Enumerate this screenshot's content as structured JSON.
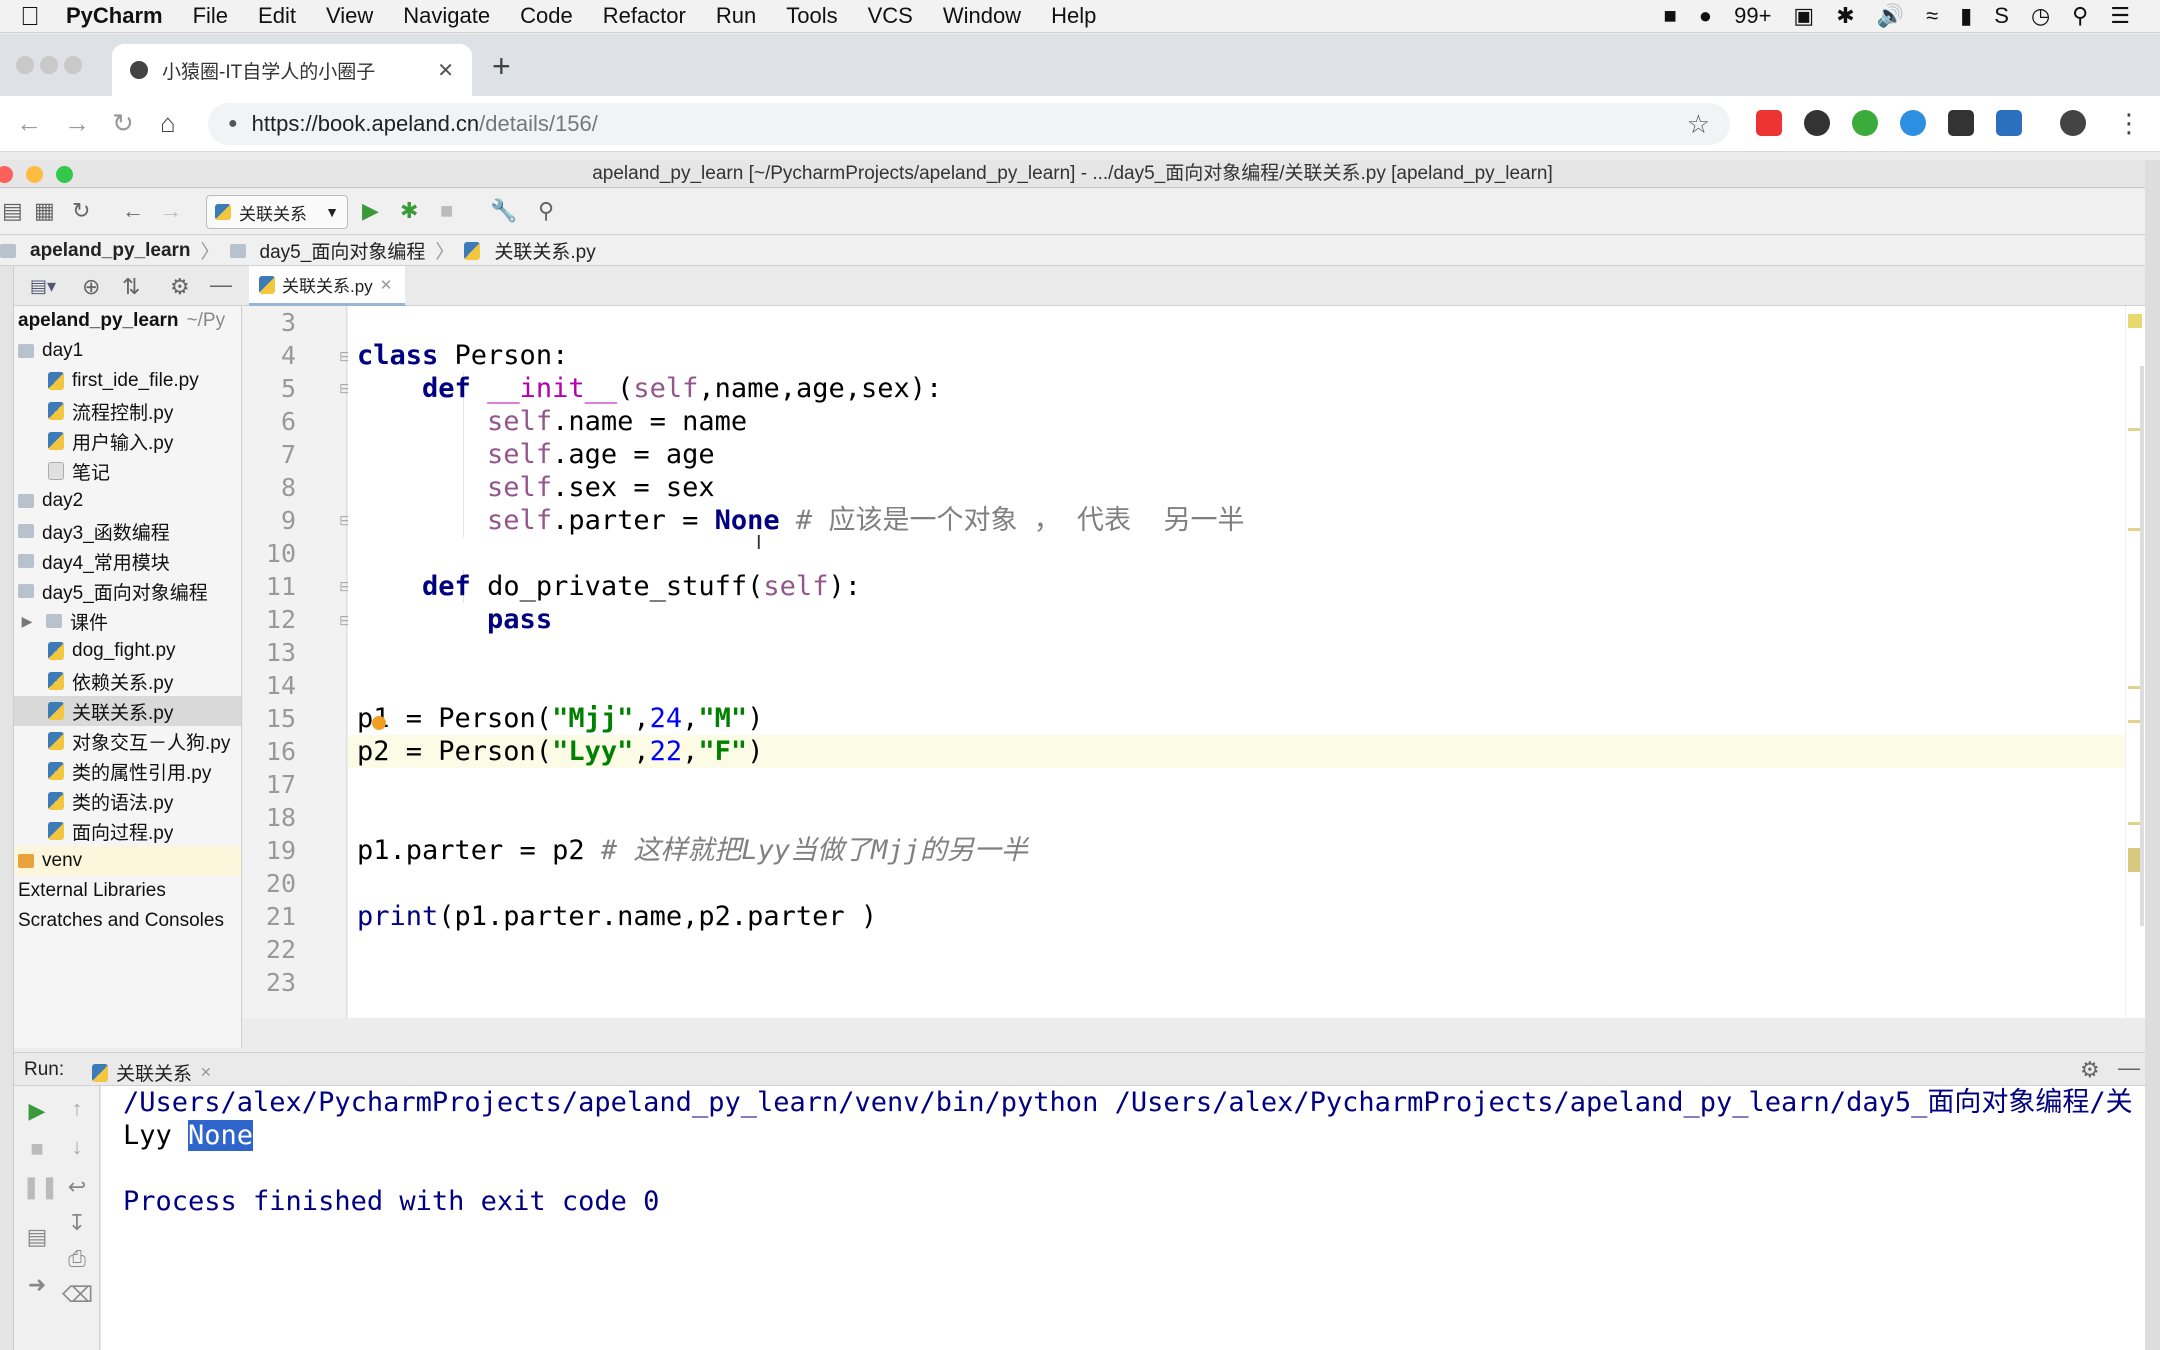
{
  "menubar": {
    "app": "PyCharm",
    "items": [
      "File",
      "Edit",
      "View",
      "Navigate",
      "Code",
      "Refactor",
      "Run",
      "Tools",
      "VCS",
      "Window",
      "Help"
    ],
    "badge": "99+"
  },
  "browser": {
    "tab_title": "小猿圈-IT自学人的小圈子",
    "url_scheme_host": "https://book.apeland.cn",
    "url_path": "/details/156/"
  },
  "window": {
    "title": "apeland_py_learn [~/PycharmProjects/apeland_py_learn] - .../day5_面向对象编程/关联关系.py [apeland_py_learn]"
  },
  "toolbar": {
    "run_config": "关联关系"
  },
  "breadcrumb": {
    "project": "apeland_py_learn",
    "folder": "day5_面向对象编程",
    "file": "关联关系.py"
  },
  "project_tree": {
    "root": "apeland_py_learn",
    "root_path": "~/Py",
    "items": [
      {
        "label": "day1",
        "icon": "folder"
      },
      {
        "label": "first_ide_file.py",
        "icon": "python"
      },
      {
        "label": "流程控制.py",
        "icon": "python"
      },
      {
        "label": "用户输入.py",
        "icon": "python"
      },
      {
        "label": "笔记",
        "icon": "text"
      },
      {
        "label": "day2",
        "icon": "folder"
      },
      {
        "label": "day3_函数编程",
        "icon": "folder"
      },
      {
        "label": "day4_常用模块",
        "icon": "folder"
      },
      {
        "label": "day5_面向对象编程",
        "icon": "folder"
      },
      {
        "label": "课件",
        "icon": "folder"
      },
      {
        "label": "dog_fight.py",
        "icon": "python"
      },
      {
        "label": "依赖关系.py",
        "icon": "python"
      },
      {
        "label": "关联关系.py",
        "icon": "python"
      },
      {
        "label": "对象交互－人狗.py",
        "icon": "python"
      },
      {
        "label": "类的属性引用.py",
        "icon": "python"
      },
      {
        "label": "类的语法.py",
        "icon": "python"
      },
      {
        "label": "面向过程.py",
        "icon": "python"
      },
      {
        "label": "venv",
        "icon": "folder-orange"
      },
      {
        "label": "External Libraries",
        "icon": "none"
      },
      {
        "label": "Scratches and Consoles",
        "icon": "none"
      }
    ]
  },
  "editor": {
    "tab": "关联关系.py",
    "line_numbers": [
      "3",
      "4",
      "5",
      "6",
      "7",
      "8",
      "9",
      "10",
      "11",
      "12",
      "13",
      "14",
      "15",
      "16",
      "17",
      "18",
      "19",
      "20",
      "21",
      "22",
      "23"
    ],
    "code": {
      "l4_kw": "class",
      "l4_rest": " Person:",
      "l5_kw": "def",
      "l5_fn": "__init__",
      "l5_self": "self",
      "l5_rest": ",name,age,sex):",
      "l6_self": "self",
      "l6_rest": ".name = name",
      "l7_self": "self",
      "l7_rest": ".age = age",
      "l8_self": "self",
      "l8_rest": ".sex = sex",
      "l9_self": "self",
      "l9_rest": ".parter = ",
      "l9_none": "None",
      "l9_comment": " # 应该是一个对象 ， 代表  另一半",
      "l11_kw": "def",
      "l11_fn": " do_private_stuff(",
      "l11_self": "self",
      "l11_rest": "):",
      "l12_kw": "pass",
      "l15_a": "p1 = Person(",
      "l15_s1": "\"Mjj\"",
      "l15_c1": ",",
      "l15_n": "24",
      "l15_c2": ",",
      "l15_s2": "\"M\"",
      "l15_e": ")",
      "l16_a": "p2 = Person(",
      "l16_s1": "\"Lyy\"",
      "l16_c1": ",",
      "l16_n": "22",
      "l16_c2": ",",
      "l16_s2": "\"F\"",
      "l16_e": ")",
      "l19_a": "p1.parter = p2 ",
      "l19_comment": "# 这样就把Lyy当做了Mjj的另一半",
      "l21_fn": "print",
      "l21_rest": "(p1.parter.name,p2.parter )"
    }
  },
  "run": {
    "label": "Run:",
    "tab": "关联关系",
    "line1": "/Users/alex/PycharmProjects/apeland_py_learn/venv/bin/python /Users/alex/PycharmProjects/apeland_py_learn/day5_面向对象编程/关",
    "line2_a": "Lyy ",
    "line2_b": "None",
    "line4": "Process finished with exit code 0"
  },
  "colors": {
    "keyword": "#000080",
    "string": "#008000",
    "number": "#0000ff",
    "self": "#94558d",
    "comment": "#808080",
    "selection": "#2f65ca"
  }
}
